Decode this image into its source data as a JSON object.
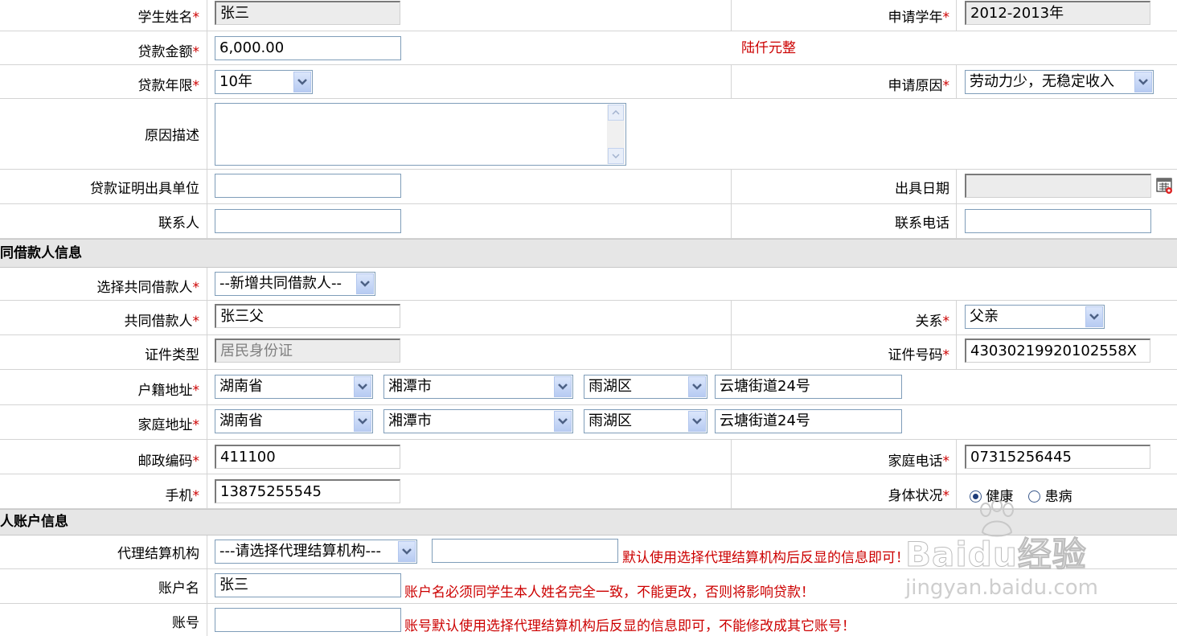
{
  "student": {
    "name_label": "学生姓名",
    "name_value": "张三",
    "year_label": "申请学年",
    "year_value": "2012-2013年"
  },
  "loan": {
    "amount_label": "贷款金额",
    "amount_value": "6,000.00",
    "amount_words": "陆仟元整",
    "term_label": "贷款年限",
    "term_value": "10年",
    "reason_label": "申请原因",
    "reason_value": "劳动力少，无稳定收入",
    "desc_label": "原因描述",
    "desc_value": "",
    "cert_unit_label": "贷款证明出具单位",
    "cert_unit_value": "",
    "cert_date_label": "出具日期",
    "cert_date_value": "",
    "contact_label": "联系人",
    "contact_value": "",
    "contact_phone_label": "联系电话",
    "contact_phone_value": ""
  },
  "co_borrower": {
    "section_title": "共同借款人信息",
    "select_label": "选择共同借款人",
    "select_value": "--新增共同借款人--",
    "name_label": "共同借款人",
    "name_value": "张三父",
    "relation_label": "关系",
    "relation_value": "父亲",
    "id_type_label": "证件类型",
    "id_type_value": "居民身份证",
    "id_no_label": "证件号码",
    "id_no_value": "43030219920102558X",
    "hukou_label": "户籍地址",
    "hukou": {
      "province": "湖南省",
      "city": "湘潭市",
      "district": "雨湖区",
      "street": "云塘街道24号"
    },
    "home_label": "家庭地址",
    "home": {
      "province": "湖南省",
      "city": "湘潭市",
      "district": "雨湖区",
      "street": "云塘街道24号"
    },
    "zip_label": "邮政编码",
    "zip_value": "411100",
    "home_phone_label": "家庭电话",
    "home_phone_value": "07315256445",
    "mobile_label": "手机",
    "mobile_value": "13875255545",
    "health_label": "身体状况",
    "health_opt1": "健康",
    "health_opt2": "患病"
  },
  "account": {
    "section_title": "个人账户信息",
    "agency_label": "代理结算机构",
    "agency_value": "---请选择代理结算机构---",
    "agency_extra": "",
    "agency_note": "默认使用选择代理结算机构后反显的信息即可！",
    "acct_name_label": "账户名",
    "acct_name_value": "张三",
    "acct_name_note": "账户名必须同学生本人姓名完全一致，不能更改，否则将影响贷款！",
    "acct_no_label": "账号",
    "acct_no_value": "",
    "acct_no_note": "账号默认使用选择代理结算机构后反显的信息即可，不能修改成其它账号！"
  },
  "required_mark": "*",
  "watermark": {
    "logo": "Baidu经验",
    "url": "jingyan.baidu.com"
  },
  "colors": {
    "required": "#cc0000",
    "section_bg": "#e6e6e6",
    "input_border": "#7f9db9"
  }
}
